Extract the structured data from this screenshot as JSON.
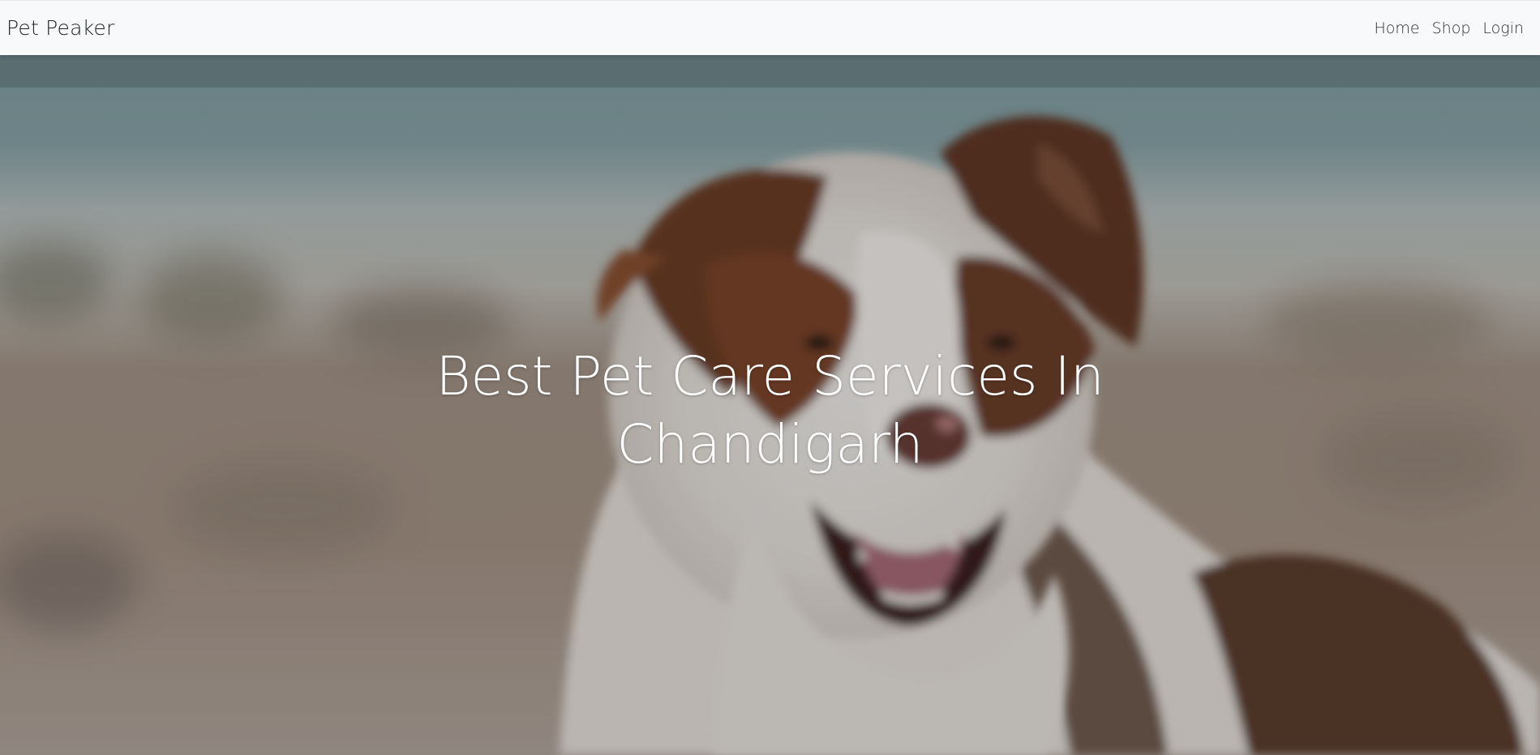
{
  "navbar": {
    "brand": "Pet Peaker",
    "links": [
      {
        "label": "Home"
      },
      {
        "label": "Shop"
      },
      {
        "label": "Login"
      }
    ]
  },
  "hero": {
    "title_line1": "Best Pet Care Services In",
    "title_line2": "Chandigarh",
    "image_subject": "dog-photo"
  },
  "colors": {
    "navbar_bg": "#f8f9fa",
    "hero_text": "#ffffff",
    "nav_text": "#2b2f33"
  }
}
